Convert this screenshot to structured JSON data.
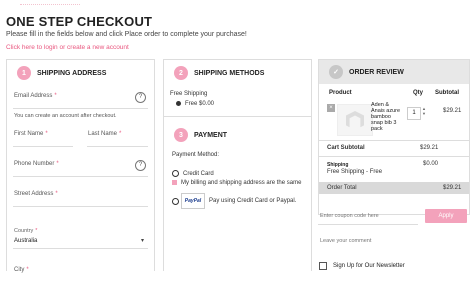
{
  "page": {
    "title": "ONE STEP CHECKOUT",
    "subtitle": "Please fill in the fields below and click Place order to complete your purchase!",
    "login_link": "Click here to login or create a new account"
  },
  "shipping_address": {
    "step": "1",
    "heading": "SHIPPING ADDRESS",
    "email_label": "Email Address",
    "account_note": "You can create an account after checkout.",
    "first_name_label": "First Name",
    "last_name_label": "Last Name",
    "phone_label": "Phone Number",
    "street_label": "Street Address",
    "country_label": "Country",
    "country_value": "Australia",
    "city_label": "City",
    "required_mark": "*",
    "help_glyph": "?"
  },
  "shipping_methods": {
    "step": "2",
    "heading": "SHIPPING METHODS",
    "carrier": "Free Shipping",
    "option": "Free $0.00"
  },
  "payment": {
    "step": "3",
    "heading": "PAYMENT",
    "method_label": "Payment Method:",
    "credit_card": "Credit Card",
    "same_address": "My billing and shipping address are the same",
    "paypal_logo": "PayPal",
    "paypal_text": "Pay using Credit Card or Paypal."
  },
  "order_review": {
    "heading": "ORDER REVIEW",
    "col_product": "Product",
    "col_qty": "Qty",
    "col_subtotal": "Subtotal",
    "item": {
      "remove": "×",
      "name_lines": [
        "Aden &",
        "Anais azure",
        "bamboo",
        "snap bib 3",
        "pack"
      ],
      "qty": "1",
      "subtotal": "$29.21"
    },
    "cart_subtotal_label": "Cart Subtotal",
    "cart_subtotal_value": "$29.21",
    "shipping_label": "Shipping",
    "shipping_method": "Free Shipping - Free",
    "shipping_value": "$0.00",
    "order_total_label": "Order Total",
    "order_total_value": "$29.21",
    "coupon_placeholder": "Enter coupon code here",
    "apply_label": "Apply",
    "comment_placeholder": "Leave your comment",
    "newsletter_label": "Sign Up for Our Newsletter"
  },
  "colors": {
    "accent_pink": "#f3a2bb",
    "link_pink": "#e9577f"
  }
}
